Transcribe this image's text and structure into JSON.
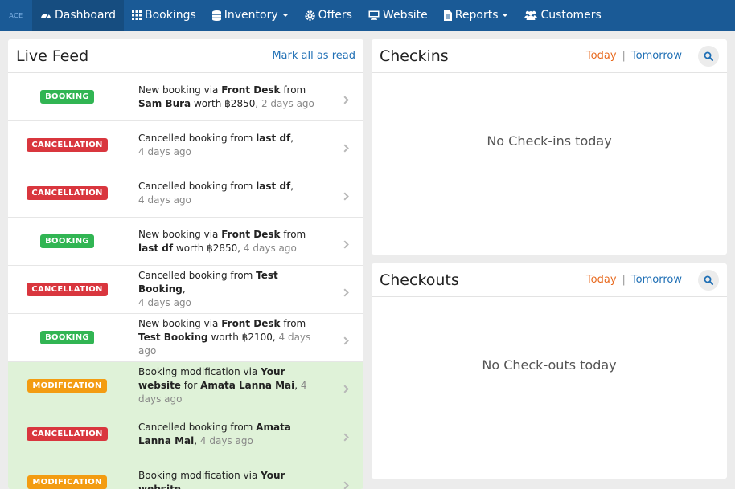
{
  "nav": {
    "brand": "ACE",
    "items": [
      {
        "label": "Dashboard",
        "icon": "dashboard-icon",
        "active": true
      },
      {
        "label": "Bookings",
        "icon": "grid-icon"
      },
      {
        "label": "Inventory",
        "icon": "database-icon",
        "dropdown": true
      },
      {
        "label": "Offers",
        "icon": "gear-icon"
      },
      {
        "label": "Website",
        "icon": "monitor-icon"
      },
      {
        "label": "Reports",
        "icon": "file-icon",
        "dropdown": true
      },
      {
        "label": "Customers",
        "icon": "users-icon"
      }
    ]
  },
  "live_feed": {
    "title": "Live Feed",
    "mark_all": "Mark all as read",
    "rows": [
      {
        "type": "booking",
        "badge": "BOOKING",
        "highlight": false,
        "parts": [
          [
            "New booking via ",
            0
          ],
          [
            "Front Desk",
            1
          ],
          [
            " from ",
            0
          ],
          [
            "Sam Bura",
            1
          ],
          [
            " worth ฿2850, ",
            0
          ]
        ],
        "time": "2 days ago"
      },
      {
        "type": "cancellation",
        "badge": "CANCELLATION",
        "highlight": false,
        "parts": [
          [
            "Cancelled booking from ",
            0
          ],
          [
            "last df",
            1
          ],
          [
            ",",
            0
          ]
        ],
        "break": true,
        "time": "4 days ago"
      },
      {
        "type": "cancellation",
        "badge": "CANCELLATION",
        "highlight": false,
        "parts": [
          [
            "Cancelled booking from ",
            0
          ],
          [
            "last df",
            1
          ],
          [
            ",",
            0
          ]
        ],
        "break": true,
        "time": "4 days ago"
      },
      {
        "type": "booking",
        "badge": "BOOKING",
        "highlight": false,
        "parts": [
          [
            "New booking via ",
            0
          ],
          [
            "Front Desk",
            1
          ],
          [
            " from ",
            0
          ],
          [
            "last df",
            1
          ],
          [
            " worth ฿2850, ",
            0
          ]
        ],
        "time": "4 days ago"
      },
      {
        "type": "cancellation",
        "badge": "CANCELLATION",
        "highlight": false,
        "parts": [
          [
            "Cancelled booking from ",
            0
          ],
          [
            "Test Booking",
            1
          ],
          [
            ",",
            0
          ]
        ],
        "break": true,
        "time": "4 days ago"
      },
      {
        "type": "booking",
        "badge": "BOOKING",
        "highlight": false,
        "parts": [
          [
            "New booking via ",
            0
          ],
          [
            "Front Desk",
            1
          ],
          [
            " from ",
            0
          ],
          [
            "Test Booking",
            1
          ],
          [
            " worth ฿2100, ",
            0
          ]
        ],
        "time": "4 days ago"
      },
      {
        "type": "modification",
        "badge": "MODIFICATION",
        "highlight": true,
        "parts": [
          [
            "Booking modification via ",
            0
          ],
          [
            "Your website",
            1
          ],
          [
            " for ",
            0
          ],
          [
            "Amata Lanna Mai",
            1
          ],
          [
            ", ",
            0
          ]
        ],
        "time": "4 days ago"
      },
      {
        "type": "cancellation",
        "badge": "CANCELLATION",
        "highlight": true,
        "parts": [
          [
            "Cancelled booking from ",
            0
          ],
          [
            "Amata Lanna Mai",
            1
          ],
          [
            ", ",
            0
          ]
        ],
        "time": "4 days ago"
      },
      {
        "type": "modification",
        "badge": "MODIFICATION",
        "highlight": true,
        "parts": [
          [
            "Booking modification via ",
            0
          ],
          [
            "Your website",
            1
          ]
        ],
        "time": ""
      }
    ]
  },
  "checkins": {
    "title": "Checkins",
    "today": "Today",
    "separator": "|",
    "tomorrow": "Tomorrow",
    "empty": "No Check-ins today"
  },
  "checkouts": {
    "title": "Checkouts",
    "today": "Today",
    "separator": "|",
    "tomorrow": "Tomorrow",
    "empty": "No Check-outs today"
  },
  "colors": {
    "nav_bg": "#1a5a96",
    "booking": "#31b553",
    "cancellation": "#d9363e",
    "modification": "#f39c12",
    "today_link": "#e86a1f",
    "link": "#1f6fb5",
    "highlight_row": "#dff2d8"
  }
}
